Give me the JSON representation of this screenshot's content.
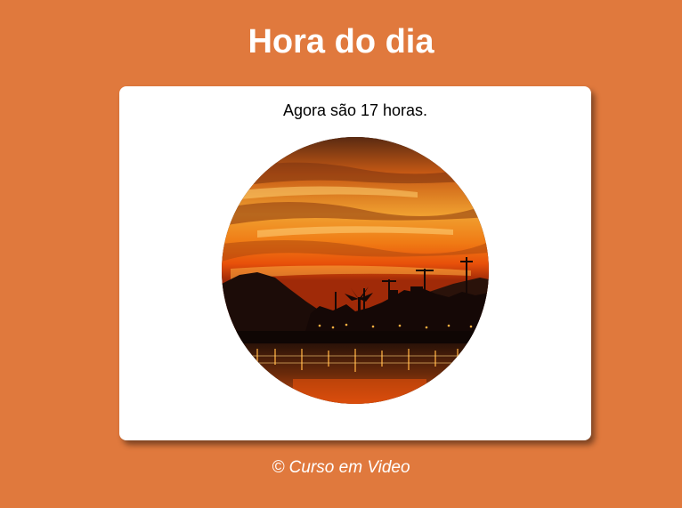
{
  "page": {
    "title": "Hora do dia",
    "background_color": "#E0793D"
  },
  "clock": {
    "message": "Agora são 17 horas.",
    "image_icon": "sunset-photo"
  },
  "footer": {
    "text": "© Curso em Video"
  }
}
